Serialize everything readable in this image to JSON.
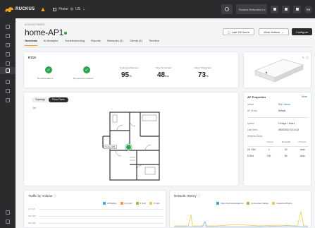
{
  "topbar": {
    "brand": "RUCKUS",
    "breadcrumb": "Home",
    "location": "US",
    "tenant": "Ruckus Networks Inc",
    "avatar": "RB"
  },
  "header": {
    "crumb": "ACCESS POINTS",
    "title": "home-AP1",
    "time_range": "Last 24 Hours",
    "more_actions": "More Actions",
    "configure": "Configure"
  },
  "tabs": [
    {
      "label": "Overview",
      "active": true
    },
    {
      "label": "AI Analytics"
    },
    {
      "label": "Troubleshooting"
    },
    {
      "label": "Reports"
    },
    {
      "label": "Networks (2)"
    },
    {
      "label": "Clients (4)"
    },
    {
      "label": "Timeline"
    }
  ],
  "summary": {
    "model": "R710",
    "kpis": [
      {
        "label": "No active alarms"
      },
      {
        "label": "No reported incidents"
      }
    ],
    "metrics": [
      {
        "label": "Connected Success",
        "value": "95",
        "unit": "%"
      },
      {
        "label": "Time To Connect",
        "value": "48",
        "unit": "ms"
      },
      {
        "label": "Client Throughput",
        "value": "73",
        "unit": "%"
      }
    ]
  },
  "map": {
    "toggle_left": "Topology",
    "toggle_right": "Floor Plans",
    "link": "1st",
    "ap_badge": "home-AP1"
  },
  "ap_properties": {
    "title": "AP Properties",
    "more": "More",
    "rows": [
      {
        "label": "Venue",
        "value": "R&D Venue",
        "link": true
      },
      {
        "label": "AP Group",
        "value": "Default"
      },
      {
        "label": "Uptime",
        "value": "16 days 7 Hours"
      },
      {
        "label": "Last Seen",
        "value": "09/20/2022 10:14:22"
      },
      {
        "label": "Wireless Radio",
        "value": ""
      }
    ],
    "radio_headers": [
      "Channel",
      "Bandwidth",
      "TX Power"
    ],
    "radio_rows": [
      {
        "band": "2.4 GHz",
        "values": [
          "1",
          "20",
          "Auto"
        ]
      },
      {
        "band": "5 GHz",
        "values": [
          "100",
          "80",
          "Auto"
        ]
      }
    ]
  },
  "traffic": {
    "title": "Traffic by Volume",
    "legend": [
      {
        "label": "All Radios",
        "color": "#4aa3df"
      },
      {
        "label": "2.4 GHz",
        "color": "#f2994a"
      },
      {
        "label": "5 GHz",
        "color": "#8bc34a"
      },
      {
        "label": "6 GHz",
        "color": "#f2c94c"
      }
    ],
    "y_ticks": [
      "1.2 GB",
      "900 MB",
      "600 MB"
    ]
  },
  "history": {
    "title": "Network History",
    "legend": [
      {
        "label": "Client Auth Associations",
        "color": "#4aa3df"
      },
      {
        "label": "Connection Failure",
        "color": "#f2994a"
      },
      {
        "label": "Impacted Clients",
        "color": "#f2c94c"
      }
    ]
  },
  "colors": {
    "accent": "#f7a21b",
    "success": "#2ea44f",
    "dark": "#2b2b2e"
  }
}
